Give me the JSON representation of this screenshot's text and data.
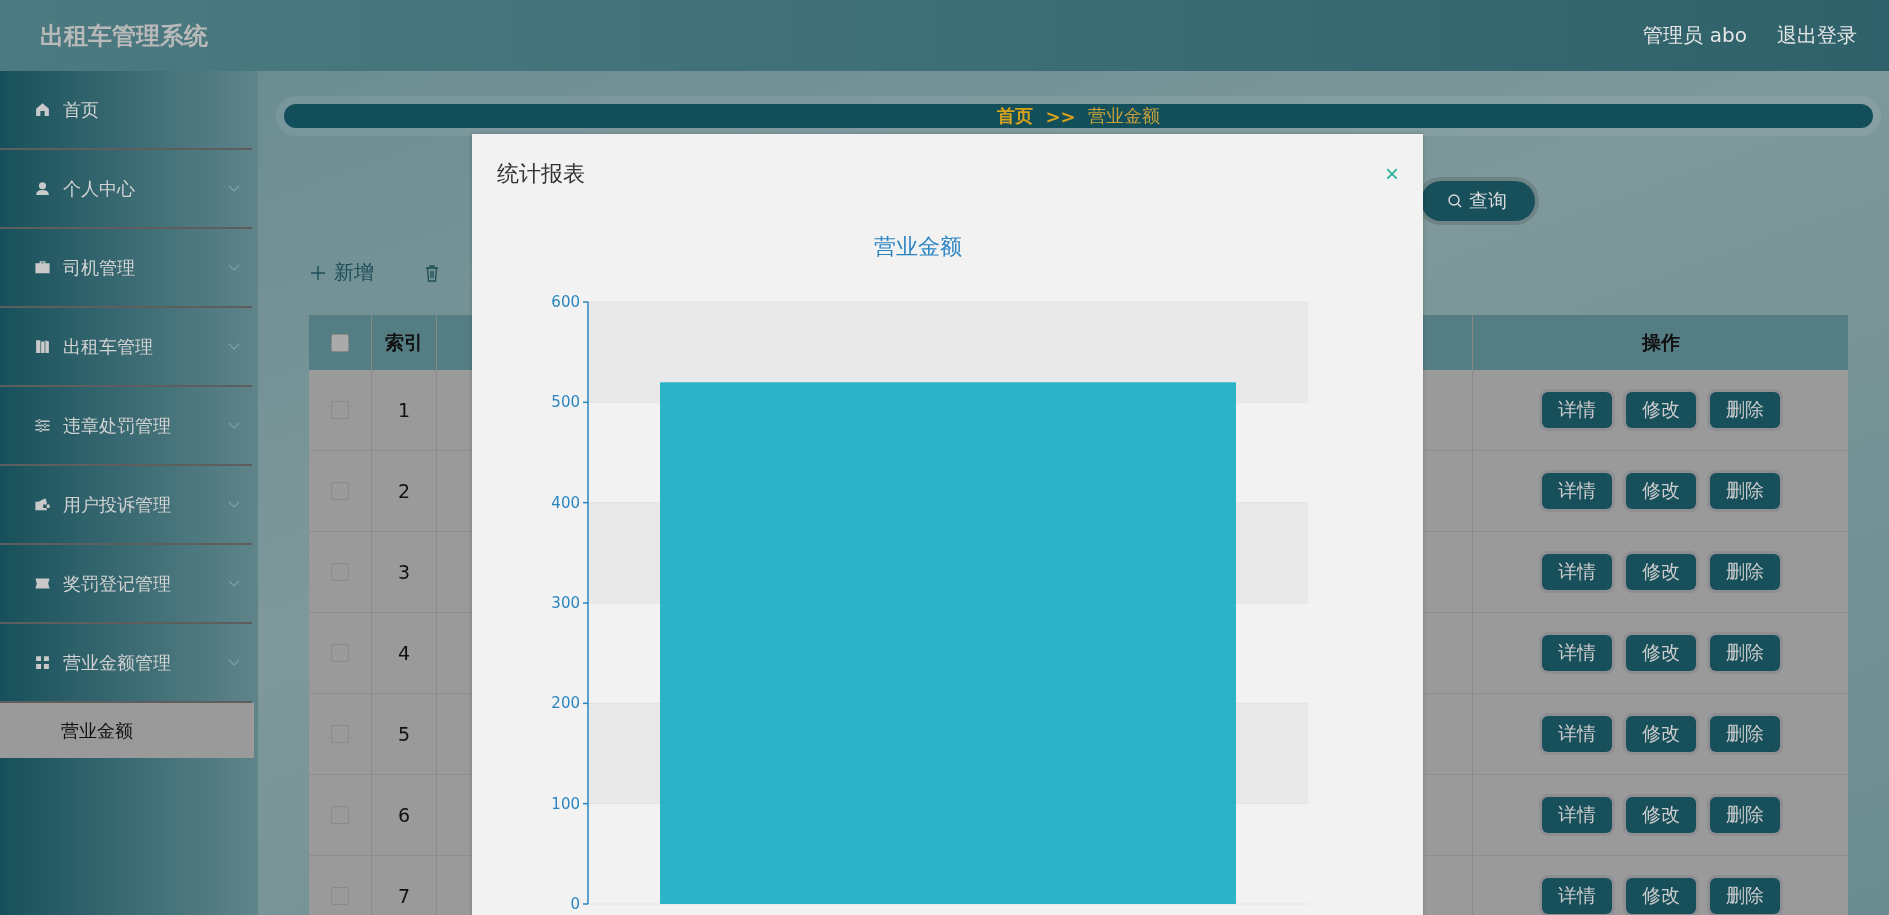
{
  "header": {
    "title": "出租车管理系统",
    "user": "管理员 abo",
    "logout": "退出登录"
  },
  "sidebar": {
    "items": [
      {
        "label": "首页",
        "has_children": false
      },
      {
        "label": "个人中心",
        "has_children": true,
        "expanded": false
      },
      {
        "label": "司机管理",
        "has_children": true,
        "expanded": false
      },
      {
        "label": "出租车管理",
        "has_children": true,
        "expanded": false
      },
      {
        "label": "违章处罚管理",
        "has_children": true,
        "expanded": false
      },
      {
        "label": "用户投诉管理",
        "has_children": true,
        "expanded": false
      },
      {
        "label": "奖罚登记管理",
        "has_children": true,
        "expanded": false
      },
      {
        "label": "营业金额管理",
        "has_children": true,
        "expanded": true,
        "children": [
          {
            "label": "营业金额",
            "selected": true
          }
        ]
      }
    ]
  },
  "breadcrumb": {
    "home": "首页",
    "separator": ">>",
    "current": "营业金额"
  },
  "search": {
    "button": "查询"
  },
  "toolbar": {
    "add": "新增"
  },
  "table": {
    "columns": [
      "索引",
      "操作"
    ],
    "header_checked": false,
    "rows": [
      {
        "checked": false,
        "index": "1",
        "actions": [
          "详情",
          "修改",
          "删除"
        ]
      },
      {
        "checked": false,
        "index": "2",
        "actions": [
          "详情",
          "修改",
          "删除"
        ]
      },
      {
        "checked": false,
        "index": "3",
        "actions": [
          "详情",
          "修改",
          "删除"
        ]
      },
      {
        "checked": false,
        "index": "4",
        "actions": [
          "详情",
          "修改",
          "删除"
        ]
      },
      {
        "checked": false,
        "index": "5",
        "actions": [
          "详情",
          "修改",
          "删除"
        ]
      },
      {
        "checked": false,
        "index": "6",
        "actions": [
          "详情",
          "修改",
          "删除"
        ]
      },
      {
        "checked": false,
        "index": "7",
        "actions": [
          "详情",
          "修改",
          "删除"
        ]
      }
    ]
  },
  "dialog": {
    "title": "统计报表",
    "close": "×",
    "chart_data": {
      "type": "bar",
      "title": "营业金额",
      "grid": true,
      "ylim": [
        0,
        600
      ],
      "yticks": [
        0,
        100,
        200,
        300,
        400,
        500,
        600
      ],
      "series": [
        {
          "color": "#2cb3c8",
          "values": [
            520
          ]
        }
      ]
    }
  }
}
